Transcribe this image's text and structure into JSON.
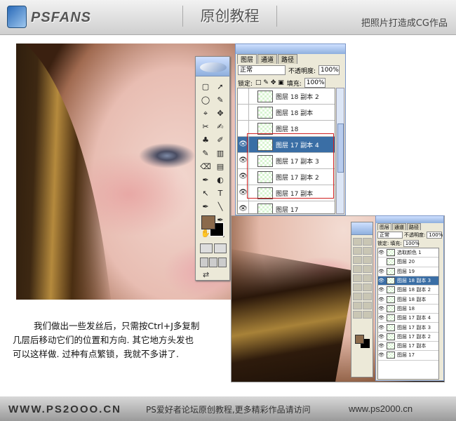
{
  "header": {
    "logo_text": "PSFANS",
    "title": "原创教程",
    "subtitle": "把照片打造成CG作品"
  },
  "footer": {
    "site_left": "WWW.PS2OOO.CN",
    "slogan": "PS爱好者论坛原创教程,更多精彩作品请访问",
    "site_right": "www.ps2000.cn"
  },
  "description": [
    "我们做出一些发丝后，只需按Ctrl+J多复制",
    "几层后移动它们的位置和方向. 其它地方头发也",
    "可以这样做. 过种有点繁锁，我就不多讲了."
  ],
  "layers_panel": {
    "tabs": [
      "图层",
      "通道",
      "路径"
    ],
    "blend_mode": "正常",
    "opacity_label": "不透明度:",
    "opacity_value": "100%",
    "lock_label": "锁定:",
    "fill_label": "填充:",
    "fill_value": "100%",
    "layers": [
      {
        "name": "图层 18 副本 2",
        "visible": false
      },
      {
        "name": "图层 18 副本",
        "visible": false
      },
      {
        "name": "图层 18",
        "visible": false
      },
      {
        "name": "图层 17 副本 4",
        "visible": true,
        "selected": true
      },
      {
        "name": "图层 17 副本 3",
        "visible": true
      },
      {
        "name": "图层 17 副本 2",
        "visible": true
      },
      {
        "name": "图层 17 副本",
        "visible": true
      },
      {
        "name": "图层 17",
        "visible": true
      }
    ]
  },
  "layers_panel_small": {
    "tabs": [
      "图层",
      "通道",
      "路径"
    ],
    "blend_mode": "正常",
    "opacity_label": "不透明度:",
    "opacity_value": "100%",
    "lock_label": "锁定:",
    "fill_label": "填充:",
    "fill_value": "100%",
    "layers": [
      {
        "name": "选取颜色 1",
        "visible": true
      },
      {
        "name": "图层 20",
        "visible": false
      },
      {
        "name": "图层 19",
        "visible": true
      },
      {
        "name": "图层 18 副本 3",
        "visible": true,
        "selected": true
      },
      {
        "name": "图层 18 副本 2",
        "visible": true
      },
      {
        "name": "图层 18 副本",
        "visible": true
      },
      {
        "name": "图层 18",
        "visible": true
      },
      {
        "name": "图层 17 副本 4",
        "visible": true
      },
      {
        "name": "图层 17 副本 3",
        "visible": true
      },
      {
        "name": "图层 17 副本 2",
        "visible": true
      },
      {
        "name": "图层 17 副本",
        "visible": true
      },
      {
        "name": "图层 17",
        "visible": true
      }
    ]
  },
  "tools": [
    "▢",
    "➚",
    "◯",
    "✎",
    "⌖",
    "✥",
    "✂",
    "✍",
    "♣",
    "✐",
    "✎",
    "▥",
    "⌫",
    "▤",
    "✒",
    "◐",
    "↖",
    "T",
    "✒",
    "╲",
    "▦",
    "✒",
    "✋",
    "🔍"
  ],
  "colors": {
    "foreground": "#8b6a4b",
    "background": "#000000",
    "selected_layer": "#3a6ea5"
  }
}
